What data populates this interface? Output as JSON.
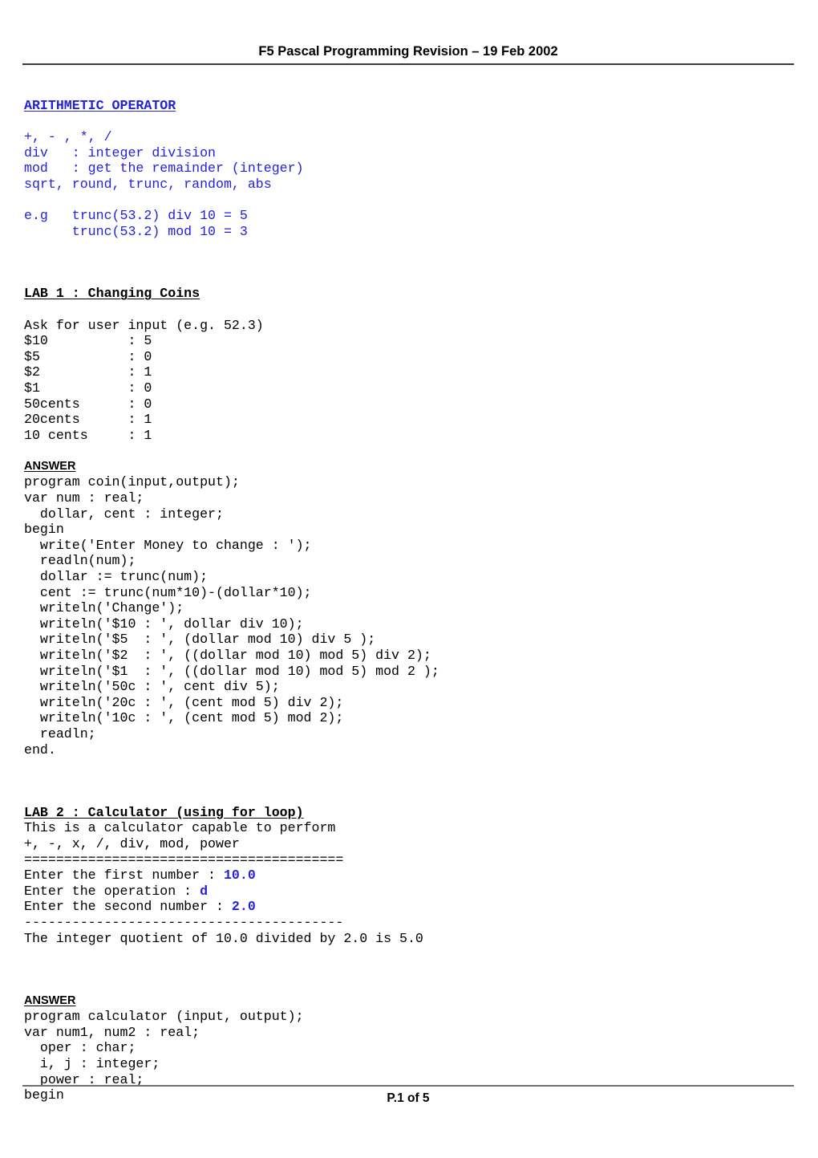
{
  "document": {
    "header_title": "F5 Pascal Programming Revision – 19 Feb 2002",
    "footer_text": "P.1 of 5",
    "accent_blue": "#2222dd",
    "text_black": "#000000"
  },
  "sections": {
    "arithmetic": {
      "heading": "ARITHMETIC OPERATOR",
      "lines": [
        "+, - , *, /",
        "div   : integer division",
        "mod   : get the remainder (integer)",
        "sqrt, round, trunc, random, abs"
      ],
      "example_lines": [
        "e.g   trunc(53.2) div 10 = 5",
        "      trunc(53.2) mod 10 = 3"
      ]
    },
    "lab1": {
      "heading": "LAB 1 : Changing Coins",
      "prompt": "Ask for user input (e.g. 52.3)",
      "coin_rows": [
        {
          "label": "$10",
          "sep": ":",
          "value": "5"
        },
        {
          "label": "$5",
          "sep": ":",
          "value": "0"
        },
        {
          "label": "$2",
          "sep": ":",
          "value": "1"
        },
        {
          "label": "$1",
          "sep": ":",
          "value": "0"
        },
        {
          "label": "50cents",
          "sep": ":",
          "value": "0"
        },
        {
          "label": "20cents",
          "sep": ":",
          "value": "1"
        },
        {
          "label": "10 cents",
          "sep": ":",
          "value": "1"
        }
      ],
      "coin_block": "$10          : 5\n$5           : 0\n$2           : 1\n$1           : 0\n50cents      : 0\n20cents      : 1\n10 cents     : 1",
      "answer_label": "ANSWER",
      "code": "program coin(input,output);\nvar num : real;\n  dollar, cent : integer;\nbegin\n  write('Enter Money to change : ');\n  readln(num);\n  dollar := trunc(num);\n  cent := trunc(num*10)-(dollar*10);\n  writeln('Change');\n  writeln('$10 : ', dollar div 10);\n  writeln('$5  : ', (dollar mod 10) div 5 );\n  writeln('$2  : ', ((dollar mod 10) mod 5) div 2);\n  writeln('$1  : ', ((dollar mod 10) mod 5) mod 2 );\n  writeln('50c : ', cent div 5);\n  writeln('20c : ', (cent mod 5) div 2);\n  writeln('10c : ', (cent mod 5) mod 2);\n  readln;\nend."
    },
    "lab2": {
      "heading": "LAB 2 : Calculator (using for loop)",
      "description_line1": "This is a calculator capable to perform",
      "description_line2": "+, -, x, /, div, mod, power",
      "separator_equals": "========================================",
      "io_lines": [
        {
          "prompt": "Enter the first number : ",
          "value": "10.0"
        },
        {
          "prompt": "Enter the operation : ",
          "value": "d"
        },
        {
          "prompt": "Enter the second number : ",
          "value": "2.0"
        }
      ],
      "separator_dashes": "----------------------------------------",
      "result_line": "The integer quotient of 10.0 divided by 2.0 is 5.0",
      "answer_label": "ANSWER",
      "code": "program calculator (input, output);\nvar num1, num2 : real;\n  oper : char;\n  i, j : integer;\n  power : real;\nbegin"
    }
  }
}
